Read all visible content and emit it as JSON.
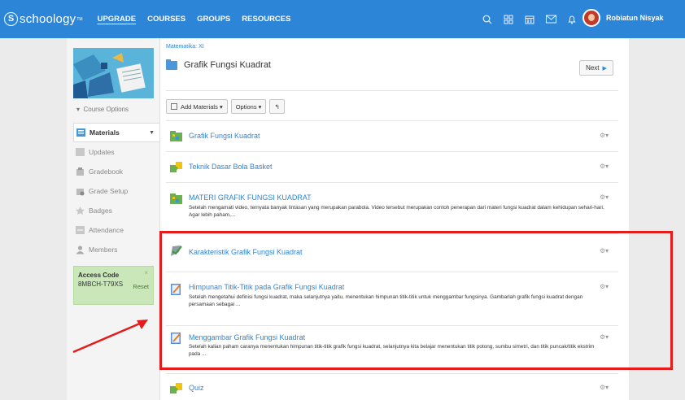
{
  "nav": {
    "logo": "schoology",
    "links": [
      "UPGRADE",
      "COURSES",
      "GROUPS",
      "RESOURCES"
    ],
    "icons": [
      "search-icon",
      "apps-grid-icon",
      "calendar-icon",
      "mail-icon",
      "notifications-bell-icon"
    ],
    "user_name": "Robiatun Nisyak",
    "accent": "#2d85d8"
  },
  "sidebar": {
    "course_options": "Course Options",
    "menu": [
      {
        "label": "Materials",
        "icon": "materials-icon"
      },
      {
        "label": "Updates",
        "icon": "updates-icon"
      },
      {
        "label": "Gradebook",
        "icon": "gradebook-icon"
      },
      {
        "label": "Grade Setup",
        "icon": "grade-setup-icon"
      },
      {
        "label": "Badges",
        "icon": "badges-icon"
      },
      {
        "label": "Attendance",
        "icon": "attendance-icon"
      },
      {
        "label": "Members",
        "icon": "members-icon"
      }
    ],
    "access_code": {
      "title": "Access Code",
      "code": "8MBCH-T79XS",
      "reset": "Reset",
      "close": "×"
    }
  },
  "main": {
    "breadcrumb": "Matematika: XI",
    "title": "Grafik Fungsi Kuadrat",
    "next": "Next",
    "toolbar": {
      "add": "Add Materials",
      "options": "Options",
      "caret": "▾",
      "back": "↰"
    },
    "gear": "⚙▾",
    "items": [
      {
        "title": "Grafik Fungsi Kuadrat",
        "desc": "",
        "icon": "folder-green-icon"
      },
      {
        "title": "Teknik Dasar Bola Basket",
        "desc": "",
        "icon": "puzzle-icon"
      },
      {
        "title": "MATERI GRAFIK FUNGSI KUADRAT",
        "desc": "Setelah mengamati video, ternyata banyak lintasan yang merupakan parabola. Video tersebut merupakan contoh penerapan dari materi fungsi kuadrat dalam kehidupan sehari-hari. Agar lebih paham,...",
        "icon": "folder-green-icon"
      },
      {
        "title": "Karakteristik Grafik Fungsi Kuadrat",
        "desc": "",
        "icon": "discussion-icon"
      },
      {
        "title": "Himpunan Titik-Titik pada Grafik Fungsi Kuadrat",
        "desc": "Setelah mengetahui definisi fungsi kuadrat, maka selanjutnya yaitu, menentukan himpunan titik-titik untuk menggambar fungsinya. Gambarlah grafik fungsi kuadrat dengan persamaan sebagai ...",
        "icon": "assignment-icon"
      },
      {
        "title": "Menggambar Grafik Fungsi Kuadrat",
        "desc": "Setelah kalian paham caranya menentukan himpunan titik-titik grafik fungsi kuadrat, selanjutnya kita belajar menentukan titik potong, sumbu simetri, dan titik puncak/titik ekstrim pada ...",
        "icon": "assignment-icon"
      },
      {
        "title": "Quiz",
        "desc": "",
        "icon": "puzzle-icon"
      }
    ]
  },
  "annotation_color": "#e51c1c"
}
